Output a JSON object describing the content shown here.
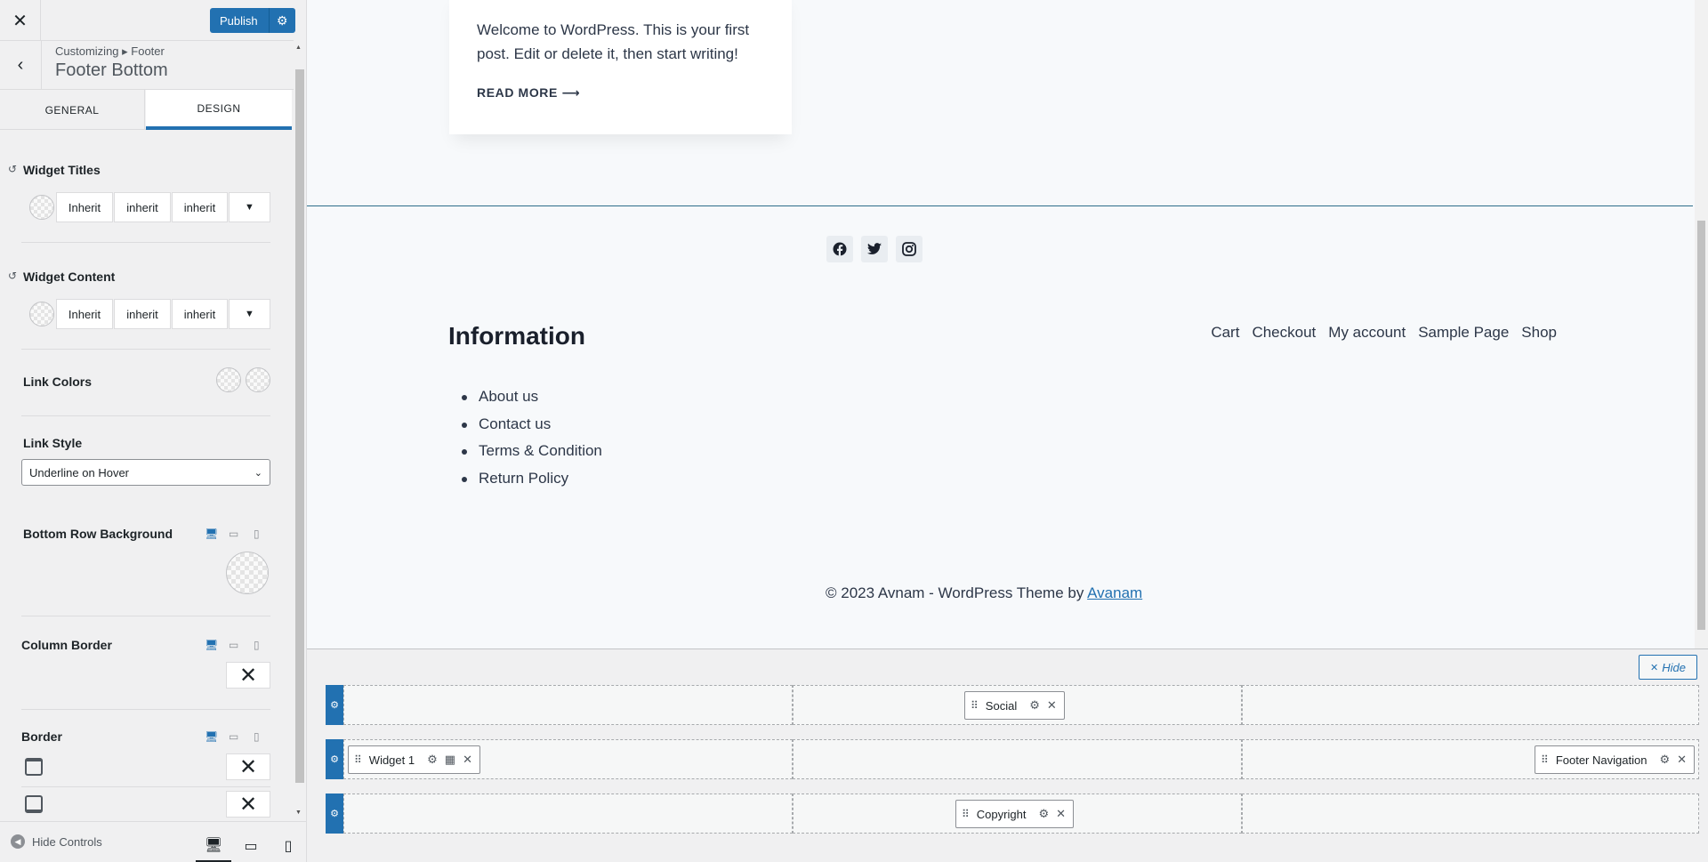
{
  "sidebar": {
    "close_icon": "close-icon",
    "publish_label": "Publish",
    "breadcrumb": "Customizing ▸ Footer",
    "section_title": "Footer Bottom",
    "tabs": [
      {
        "label": "GENERAL"
      },
      {
        "label": "DESIGN"
      }
    ],
    "active_tab": "DESIGN",
    "widget_titles": {
      "label": "Widget Titles",
      "values": [
        "Inherit",
        "inherit",
        "inherit"
      ]
    },
    "widget_content": {
      "label": "Widget Content",
      "values": [
        "Inherit",
        "inherit",
        "inherit"
      ]
    },
    "link_colors_label": "Link Colors",
    "link_style": {
      "label": "Link Style",
      "value": "Underline on Hover"
    },
    "bottom_row_background_label": "Bottom Row Background",
    "column_border_label": "Column Border",
    "border_label": "Border",
    "hide_controls_label": "Hide Controls",
    "accent": "#2271b1"
  },
  "preview": {
    "post_excerpt": "Welcome to WordPress. This is your first post. Edit or delete it, then start writing!",
    "read_more": "READ MORE ⟶",
    "social": [
      "facebook-icon",
      "twitter-icon",
      "instagram-icon"
    ],
    "widget_title": "Information",
    "widget_links": [
      "About us",
      "Contact us",
      "Terms & Condition",
      "Return Policy"
    ],
    "footer_nav": [
      "Cart",
      "Checkout",
      "My account",
      "Sample Page",
      "Shop"
    ],
    "copyright_text": "© 2023 Avnam - WordPress Theme by ",
    "copyright_link": "Avanam"
  },
  "builder": {
    "hide_label": "Hide",
    "rows": [
      {
        "items": [
          {
            "label": "Social"
          }
        ]
      },
      {
        "items": [
          {
            "label": "Widget 1"
          },
          {
            "label": "Footer Navigation"
          }
        ]
      },
      {
        "items": [
          {
            "label": "Copyright"
          }
        ]
      }
    ]
  }
}
